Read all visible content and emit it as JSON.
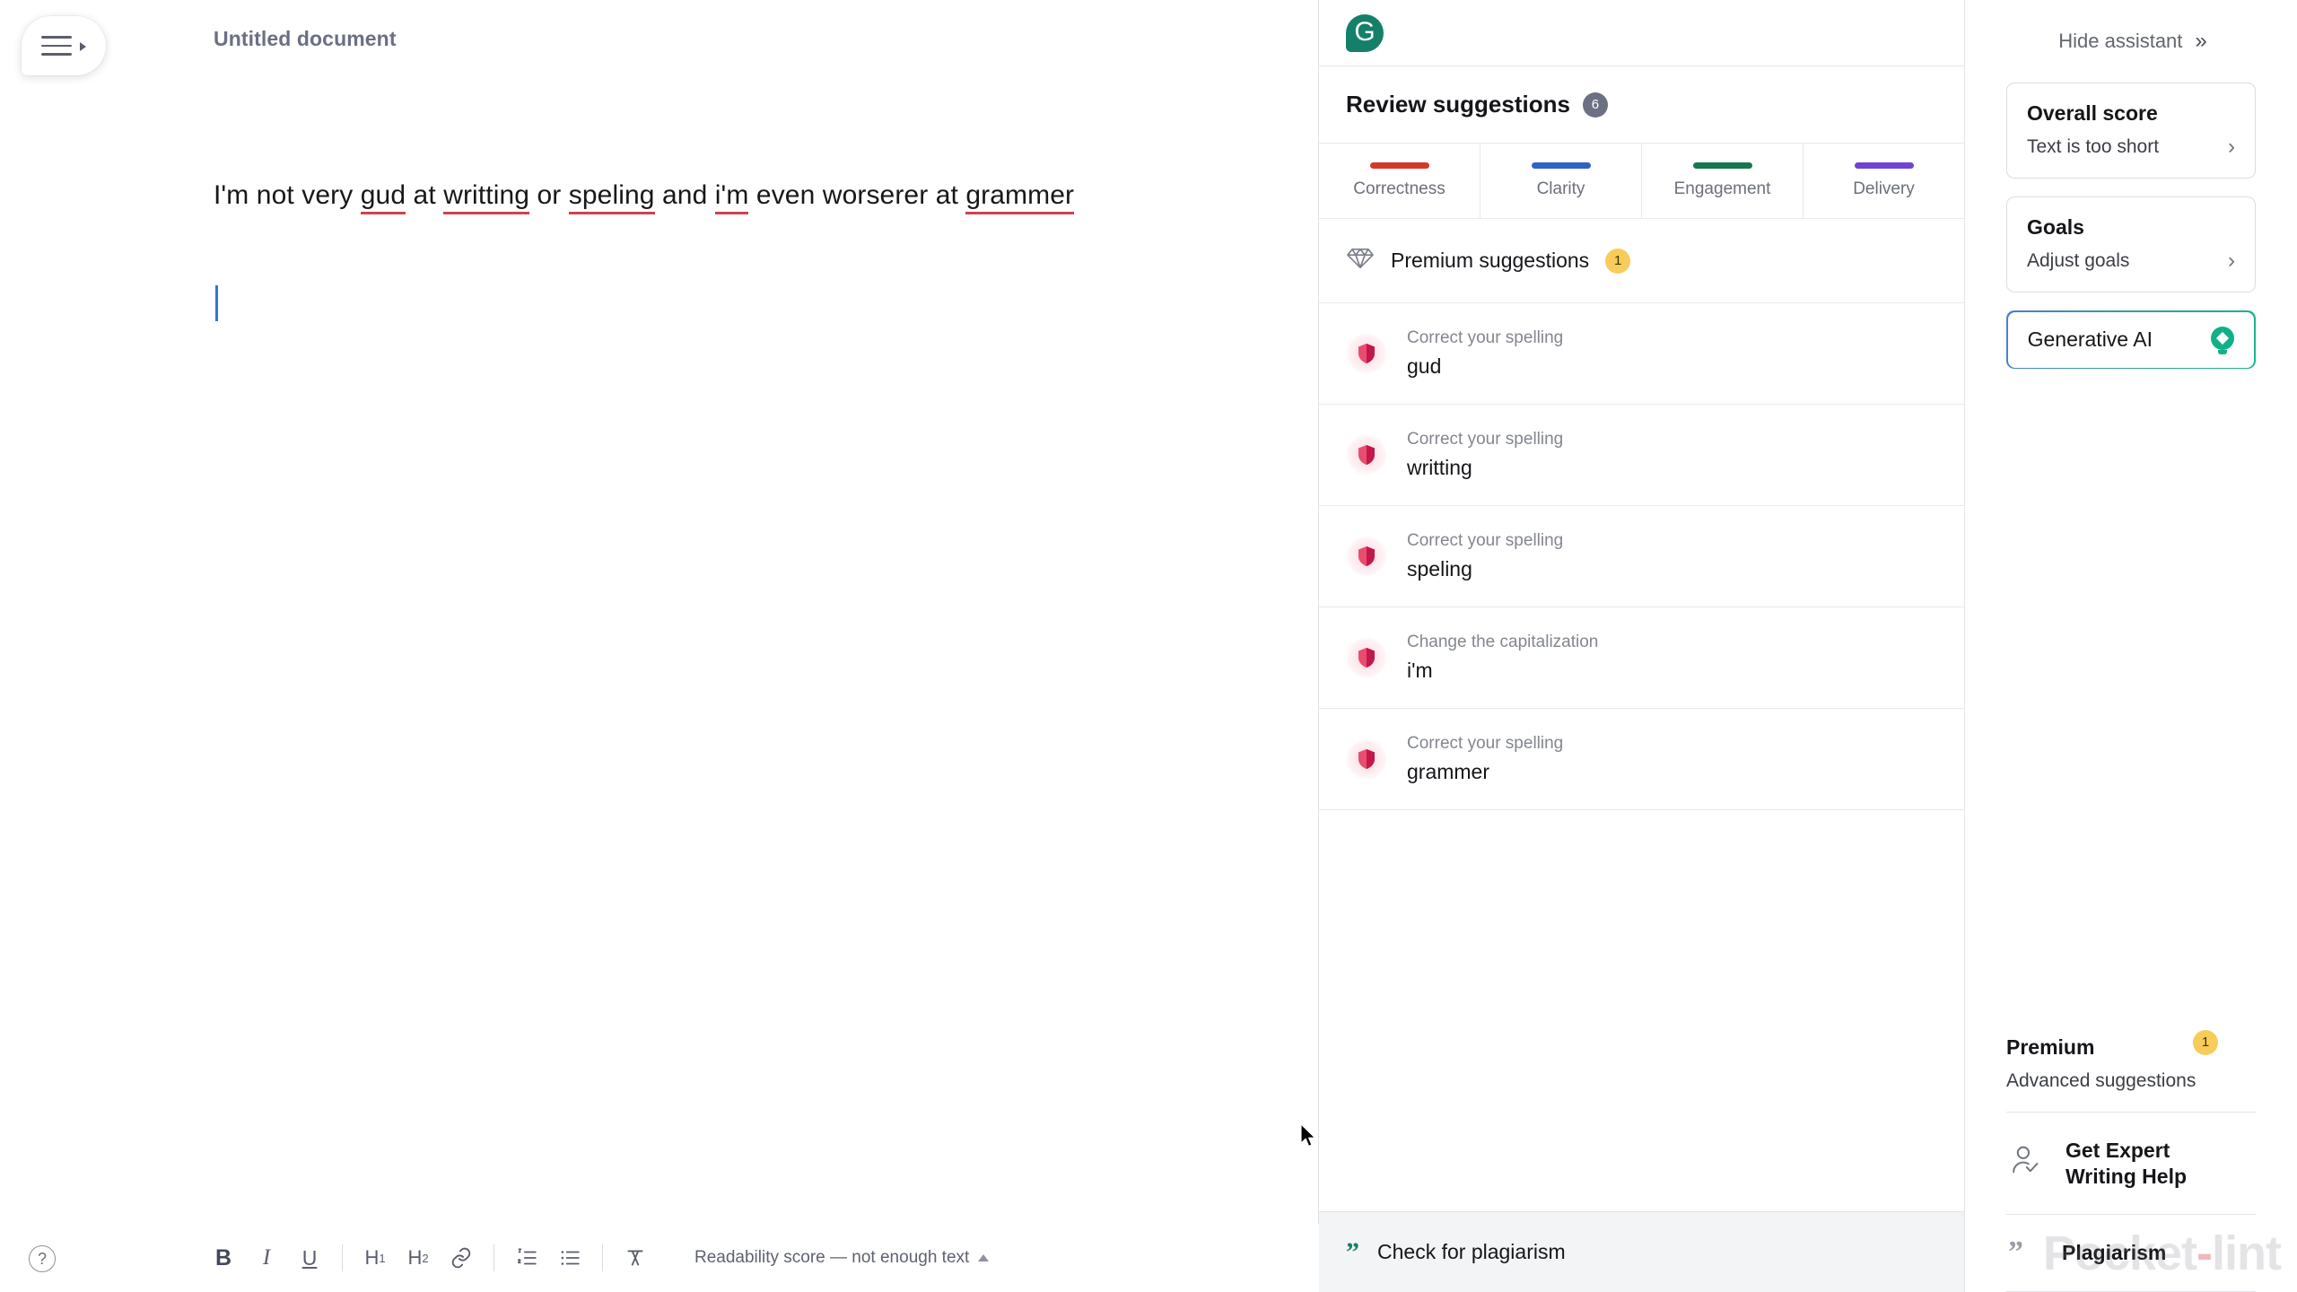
{
  "editor": {
    "menu_icon": "hamburger-menu-icon",
    "title": "Untitled document",
    "document_text": {
      "segments": [
        {
          "text": "I'm not very ",
          "error": false
        },
        {
          "text": "gud",
          "error": true
        },
        {
          "text": " at ",
          "error": false
        },
        {
          "text": "writting",
          "error": true
        },
        {
          "text": " or ",
          "error": false
        },
        {
          "text": "speling",
          "error": true
        },
        {
          "text": " and ",
          "error": false
        },
        {
          "text": "i'm",
          "error": true
        },
        {
          "text": " even worserer at ",
          "error": false
        },
        {
          "text": "grammer",
          "error": true
        }
      ],
      "plain": "I'm not very gud at writting or speling and i'm even worserer at grammer"
    },
    "toolbar": {
      "bold": "B",
      "italic": "I",
      "underline": "U",
      "heading1": "H1",
      "heading2": "H2",
      "link": "link-icon",
      "numbered_list": "numbered-list-icon",
      "bullet_list": "bullet-list-icon",
      "clear_formatting": "clear-formatting-icon",
      "readability": "Readability score — not enough text"
    },
    "help": "?"
  },
  "suggestions_panel": {
    "logo": "grammarly-logo",
    "logo_letter": "G",
    "header_title": "Review suggestions",
    "header_count": "6",
    "tabs": [
      {
        "label": "Correctness",
        "color": "#d3382b"
      },
      {
        "label": "Clarity",
        "color": "#2f63c4"
      },
      {
        "label": "Engagement",
        "color": "#17784e"
      },
      {
        "label": "Delivery",
        "color": "#6f43d6"
      }
    ],
    "premium_row": {
      "icon": "diamond-icon",
      "label": "Premium suggestions",
      "badge": "1"
    },
    "cards": [
      {
        "kind": "Correct your spelling",
        "word": "gud"
      },
      {
        "kind": "Correct your spelling",
        "word": "writting"
      },
      {
        "kind": "Correct your spelling",
        "word": "speling"
      },
      {
        "kind": "Change the capitalization",
        "word": "i'm"
      },
      {
        "kind": "Correct your spelling",
        "word": "grammer"
      }
    ],
    "footer": {
      "icon": "quote-icon",
      "label": "Check for plagiarism"
    }
  },
  "assistant": {
    "hide_label": "Hide assistant",
    "hide_icon": "chevron-double-right-icon",
    "cards": [
      {
        "title": "Overall score",
        "subtitle": "Text is too short",
        "chevron": "›"
      },
      {
        "title": "Goals",
        "subtitle": "Adjust goals",
        "chevron": "›"
      }
    ],
    "generative_ai": {
      "label": "Generative AI",
      "icon": "lightbulb-icon",
      "gradient_from": "#4a7fd4",
      "gradient_to": "#19b58e"
    },
    "premium": {
      "title": "Premium",
      "subtitle": "Advanced suggestions",
      "badge": "1"
    },
    "links": [
      {
        "label": "Get Expert\nWriting Help",
        "icon": "person-check-icon"
      },
      {
        "label": "Plagiarism",
        "icon": "quote-icon"
      }
    ],
    "watermark": "Pocket-lint"
  }
}
